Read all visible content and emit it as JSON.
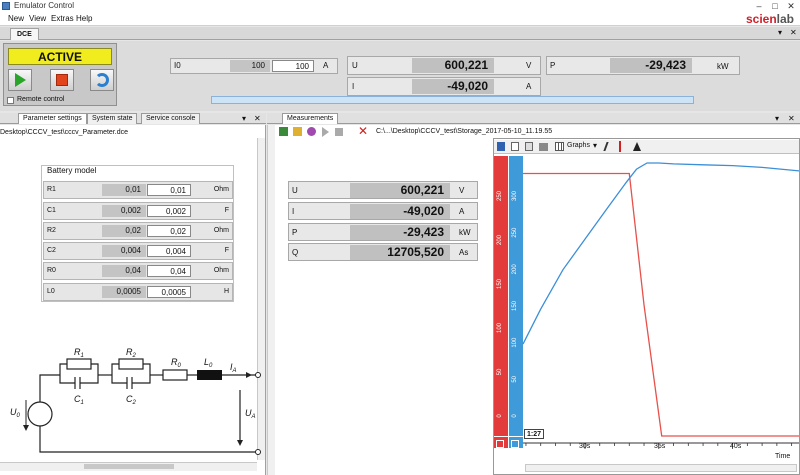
{
  "window": {
    "title": "Emulator Control",
    "minimize": "–",
    "maximize": "□",
    "close": "✕"
  },
  "menu": [
    "New",
    "View",
    "Extras",
    "Help"
  ],
  "logo": {
    "part1": "scien",
    "part2": "lab"
  },
  "doc_tab": "DCE",
  "panel_controls": {
    "pin": "▾",
    "close": "✕"
  },
  "control": {
    "status": "ACTIVE",
    "play_icon": "play-icon",
    "stop_icon": "stop-icon",
    "reset_icon": "reset-icon",
    "remote_label": "Remote control",
    "remote_checked": false
  },
  "setpoint": {
    "label": "I0",
    "actual": "100",
    "input": "100",
    "unit": "A"
  },
  "top_measurements": {
    "U": {
      "label": "U",
      "value": "600,221",
      "unit": "V"
    },
    "I": {
      "label": "I",
      "value": "-49,020",
      "unit": "A"
    },
    "P": {
      "label": "P",
      "value": "-29,423",
      "unit": "kW"
    }
  },
  "left_tabs": [
    "Parameter settings",
    "System state",
    "Service console"
  ],
  "param_file_path": "Desktop\\CCCV_test\\cccv_Parameter.dce",
  "battery_model": {
    "title": "Battery model",
    "params": [
      {
        "name": "R1",
        "actual": "0,01",
        "input": "0,01",
        "unit": "Ohm"
      },
      {
        "name": "C1",
        "actual": "0,002",
        "input": "0,002",
        "unit": "F"
      },
      {
        "name": "R2",
        "actual": "0,02",
        "input": "0,02",
        "unit": "Ohm"
      },
      {
        "name": "C2",
        "actual": "0,004",
        "input": "0,004",
        "unit": "F"
      },
      {
        "name": "R0",
        "actual": "0,04",
        "input": "0,04",
        "unit": "Ohm"
      },
      {
        "name": "L0",
        "actual": "0,0005",
        "input": "0,0005",
        "unit": "H"
      }
    ]
  },
  "circuit": {
    "R1": "R",
    "R1_sub": "1",
    "R2": "R",
    "R2_sub": "2",
    "C1": "C",
    "C1_sub": "1",
    "C2": "C",
    "C2_sub": "2",
    "R0": "R",
    "R0_sub": "0",
    "L0": "L",
    "L0_sub": "0",
    "IA": "I",
    "IA_sub": "A",
    "U0": "U",
    "U0_sub": "0",
    "UA": "U",
    "UA_sub": "A"
  },
  "measurements_tab": "Measurements",
  "storage_path": "C:\\...\\Desktop\\CCCV_test\\Storage_2017-05-10_11.19.55",
  "meas_table": [
    {
      "name": "U",
      "value": "600,221",
      "unit": "V"
    },
    {
      "name": "I",
      "value": "-49,020",
      "unit": "A"
    },
    {
      "name": "P",
      "value": "-29,423",
      "unit": "kW"
    },
    {
      "name": "Q",
      "value": "12705,520",
      "unit": "As"
    }
  ],
  "chart_toolbar": {
    "graphs_label": "Graphs"
  },
  "chart_data": {
    "type": "line",
    "xlabel": "Time",
    "x_ticks": [
      "30s",
      "35s",
      "40s"
    ],
    "cursor_label": "1:27",
    "axes": [
      {
        "name": "red-axis",
        "color": "#e33b3b",
        "ticks": [
          "250",
          "200",
          "150",
          "100",
          "50",
          "0"
        ]
      },
      {
        "name": "blue-axis",
        "color": "#3e9ad8",
        "ticks": [
          "300",
          "250",
          "200",
          "150",
          "100",
          "50",
          "0"
        ]
      }
    ],
    "series": [
      {
        "axis": "red-axis",
        "color": "#e8504a",
        "points": [
          [
            25.8,
            300
          ],
          [
            33.0,
            300
          ],
          [
            34.0,
            150
          ],
          [
            35.2,
            0
          ],
          [
            44.5,
            0
          ]
        ]
      },
      {
        "axis": "blue-axis",
        "color": "#3b8fd8",
        "points": [
          [
            25.8,
            105
          ],
          [
            27.0,
            145
          ],
          [
            28.5,
            190
          ],
          [
            30.0,
            225
          ],
          [
            31.5,
            260
          ],
          [
            32.8,
            290
          ],
          [
            33.5,
            305
          ],
          [
            34.2,
            312
          ],
          [
            35.0,
            312
          ],
          [
            36.0,
            311
          ],
          [
            38.0,
            310
          ],
          [
            40.0,
            309
          ],
          [
            42.0,
            307
          ],
          [
            44.5,
            303
          ]
        ]
      }
    ],
    "x_range": [
      25.8,
      44.5
    ],
    "y_range": [
      0,
      320
    ]
  }
}
